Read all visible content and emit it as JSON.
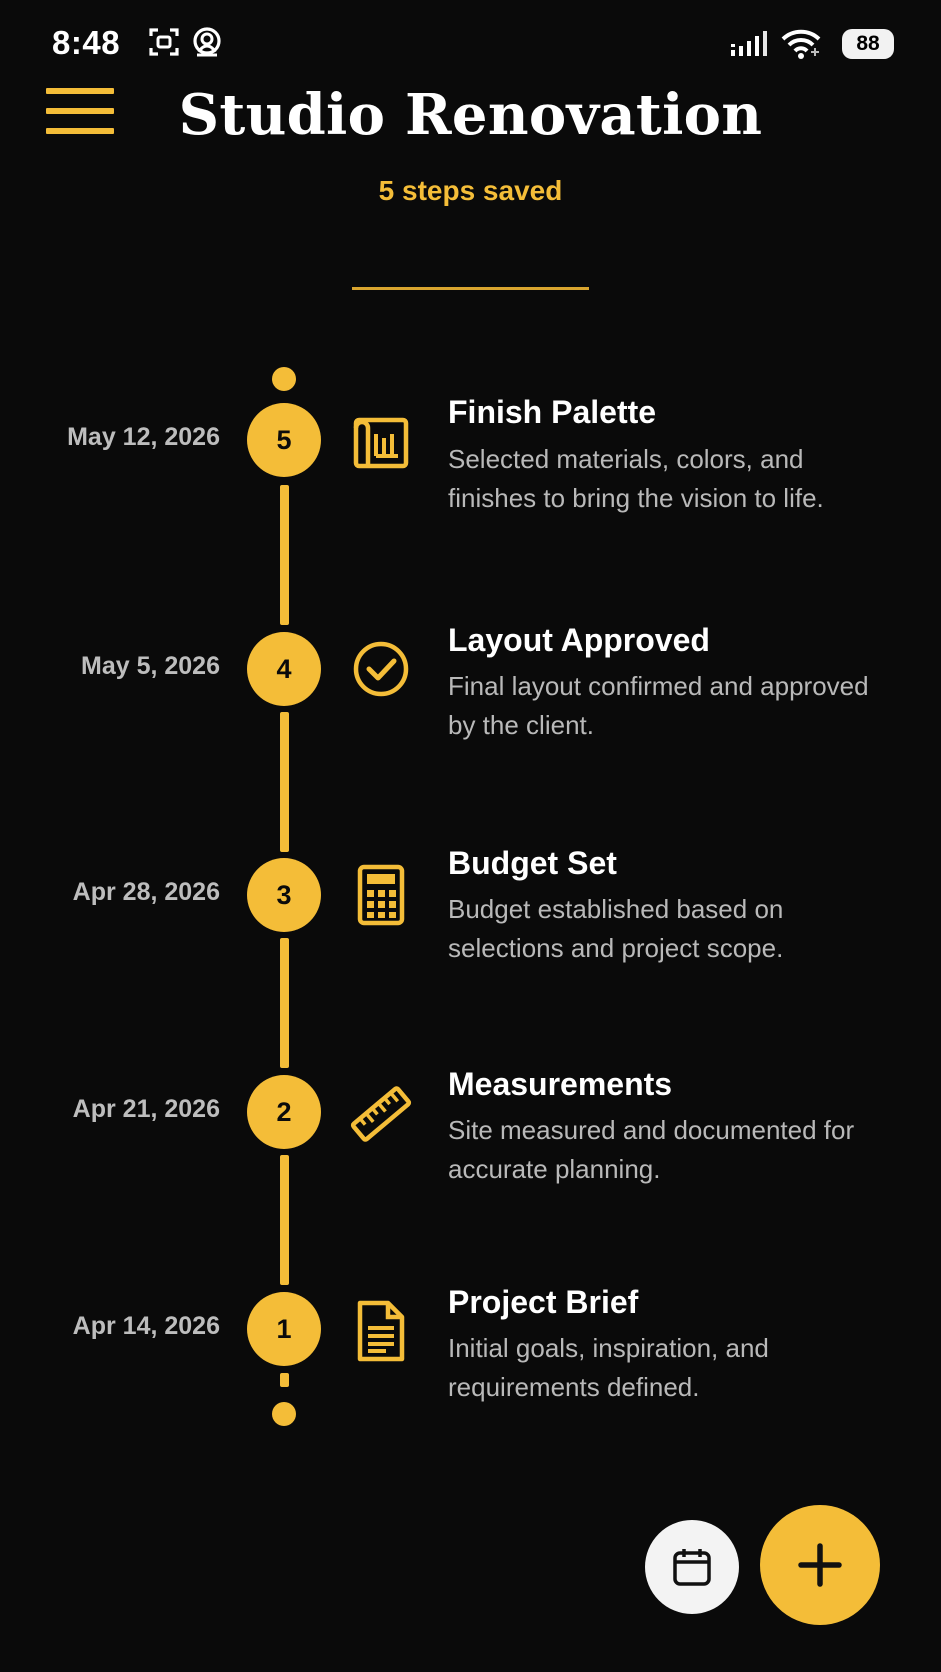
{
  "status_bar": {
    "time": "8:48",
    "battery": "88",
    "icons": [
      "screenshot-icon",
      "face-detect-icon",
      "signal-icon",
      "wifi-icon",
      "battery-icon"
    ]
  },
  "header": {
    "title": "Studio Renovation",
    "subtitle": "5 steps saved",
    "menu_icon": "hamburger-menu-icon"
  },
  "timeline": {
    "steps": [
      {
        "number": "5",
        "date": "May 12, 2026",
        "title": "Finish Palette",
        "description": "Selected materials, colors, and finishes to bring the vision to life.",
        "icon": "blueprint-icon"
      },
      {
        "number": "4",
        "date": "May 5, 2026",
        "title": "Layout Approved",
        "description": "Final layout confirmed and approved by the client.",
        "icon": "check-circle-icon"
      },
      {
        "number": "3",
        "date": "Apr 28, 2026",
        "title": "Budget Set",
        "description": "Budget established based on selections and project scope.",
        "icon": "calculator-icon"
      },
      {
        "number": "2",
        "date": "Apr 21, 2026",
        "title": "Measurements",
        "description": "Site measured and documented for accurate planning.",
        "icon": "ruler-icon"
      },
      {
        "number": "1",
        "date": "Apr 14, 2026",
        "title": "Project Brief",
        "description": "Initial goals, inspiration, and requirements defined.",
        "icon": "document-icon"
      }
    ]
  },
  "actions": {
    "calendar_icon": "calendar-icon",
    "add_icon": "plus-icon"
  },
  "colors": {
    "accent": "#f4bd38",
    "background": "#0a0a0a",
    "text_primary": "#ffffff",
    "text_secondary": "#b9b9b9"
  }
}
